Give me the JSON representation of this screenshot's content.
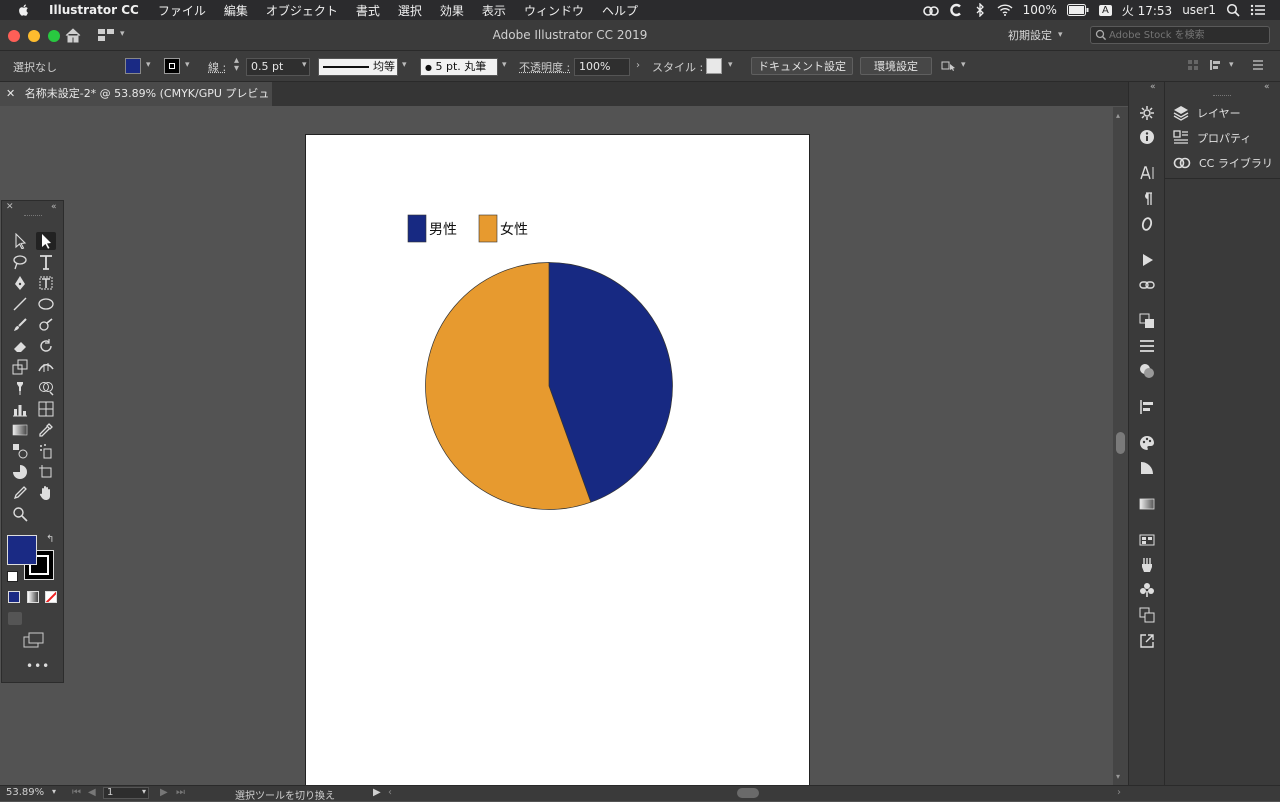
{
  "menubar": {
    "app_name": "Illustrator CC",
    "items": [
      "ファイル",
      "編集",
      "オブジェクト",
      "書式",
      "選択",
      "効果",
      "表示",
      "ウィンドウ",
      "ヘルプ"
    ],
    "battery": "100%",
    "input_method": "A",
    "clock": "火 17:53",
    "user": "user1"
  },
  "window": {
    "title": "Adobe Illustrator CC 2019",
    "workspace": "初期設定",
    "stock_search_placeholder": "Adobe Stock を検索"
  },
  "controlbar": {
    "selection_status": "選択なし",
    "fill_color": "#1a2a84",
    "stroke_label": "線 :",
    "stroke_weight": "0.5 pt",
    "stroke_profile": "均等",
    "brush": "5 pt. 丸筆",
    "opacity_label": "不透明度 :",
    "opacity_value": "100%",
    "style_label": "スタイル :",
    "document_setup": "ドキュメント設定",
    "preferences": "環境設定"
  },
  "document": {
    "tab_label": "名称未設定-2* @ 53.89% (CMYK/GPU プレビュー)"
  },
  "chart_data": {
    "type": "pie",
    "legend": [
      {
        "name": "男性",
        "color": "#172982"
      },
      {
        "name": "女性",
        "color": "#e79a2f"
      }
    ],
    "series": [
      {
        "name": "男性",
        "value": 44.5,
        "color": "#172982"
      },
      {
        "name": "女性",
        "value": 55.5,
        "color": "#e79a2f"
      }
    ],
    "legend_placement": "top-left"
  },
  "tools": {
    "fill_color": "#1a2a84"
  },
  "panels": {
    "items": [
      "レイヤー",
      "プロパティ",
      "CC ライブラリ"
    ]
  },
  "statusbar": {
    "zoom": "53.89%",
    "artboard_number": "1",
    "status_text": "選択ツールを切り換え"
  }
}
